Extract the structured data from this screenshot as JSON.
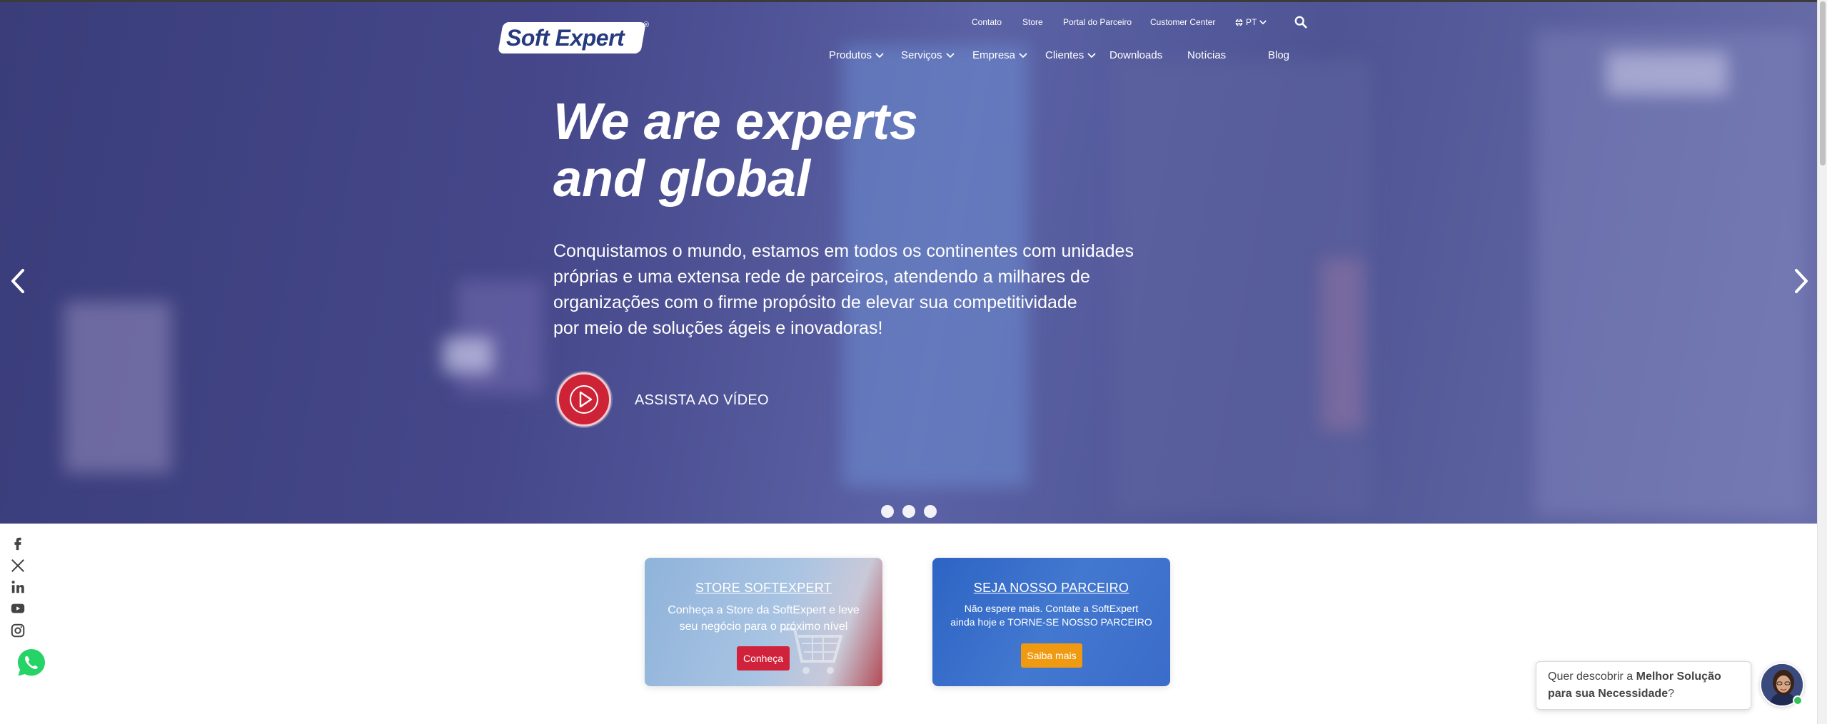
{
  "brand": {
    "logo_text": "Soft Expert",
    "registered": "®"
  },
  "utility_nav": {
    "contato": "Contato",
    "store": "Store",
    "portal": "Portal do Parceiro",
    "customer_center": "Customer Center",
    "language": "PT"
  },
  "main_nav": [
    {
      "label": "Produtos",
      "has_dropdown": true
    },
    {
      "label": "Serviços",
      "has_dropdown": true
    },
    {
      "label": "Empresa",
      "has_dropdown": true
    },
    {
      "label": "Clientes",
      "has_dropdown": true
    },
    {
      "label": "Downloads",
      "has_dropdown": false
    },
    {
      "label": "Notícias",
      "has_dropdown": false
    },
    {
      "label": "Blog",
      "has_dropdown": false
    }
  ],
  "hero": {
    "title_line1": "We are experts",
    "title_line2": "and global",
    "text_line1": "Conquistamos o mundo, estamos em todos os continentes com unidades",
    "text_line2": "próprias e uma extensa rede de parceiros, atendendo a milhares de",
    "text_line3": "organizações com o firme propósito de elevar sua competitividade",
    "text_line4": "por meio de soluções ágeis e inovadoras!",
    "video_label": "ASSISTA AO VÍDEO",
    "slide_count": 3
  },
  "cards": {
    "store": {
      "title": "STORE SOFTEXPERT",
      "text_line1": "Conheça a Store da SoftExpert e leve",
      "text_line2": "seu negócio para o próximo nível",
      "button": "Conheça"
    },
    "parceiro": {
      "title": "SEJA NOSSO PARCEIRO",
      "text_line1": "Não espere mais. Contate a SoftExpert",
      "text_line2": "ainda hoje e TORNE-SE NOSSO PARCEIRO",
      "button": "Saiba mais"
    }
  },
  "chat": {
    "text_pre": "Quer descobrir a ",
    "text_bold1": "Melhor Solução",
    "text_bold2": "para sua Necessidade",
    "text_post": "?"
  },
  "social_icons": [
    "facebook-icon",
    "x-icon",
    "linkedin-icon",
    "youtube-icon",
    "instagram-icon",
    "whatsapp-icon"
  ],
  "colors": {
    "hero_overlay": "#45478a",
    "play_red": "#ce2336",
    "store_button": "#d0223a",
    "parceiro_button": "#f09a12",
    "whatsapp": "#25d366",
    "brand_blue": "#263a80"
  }
}
